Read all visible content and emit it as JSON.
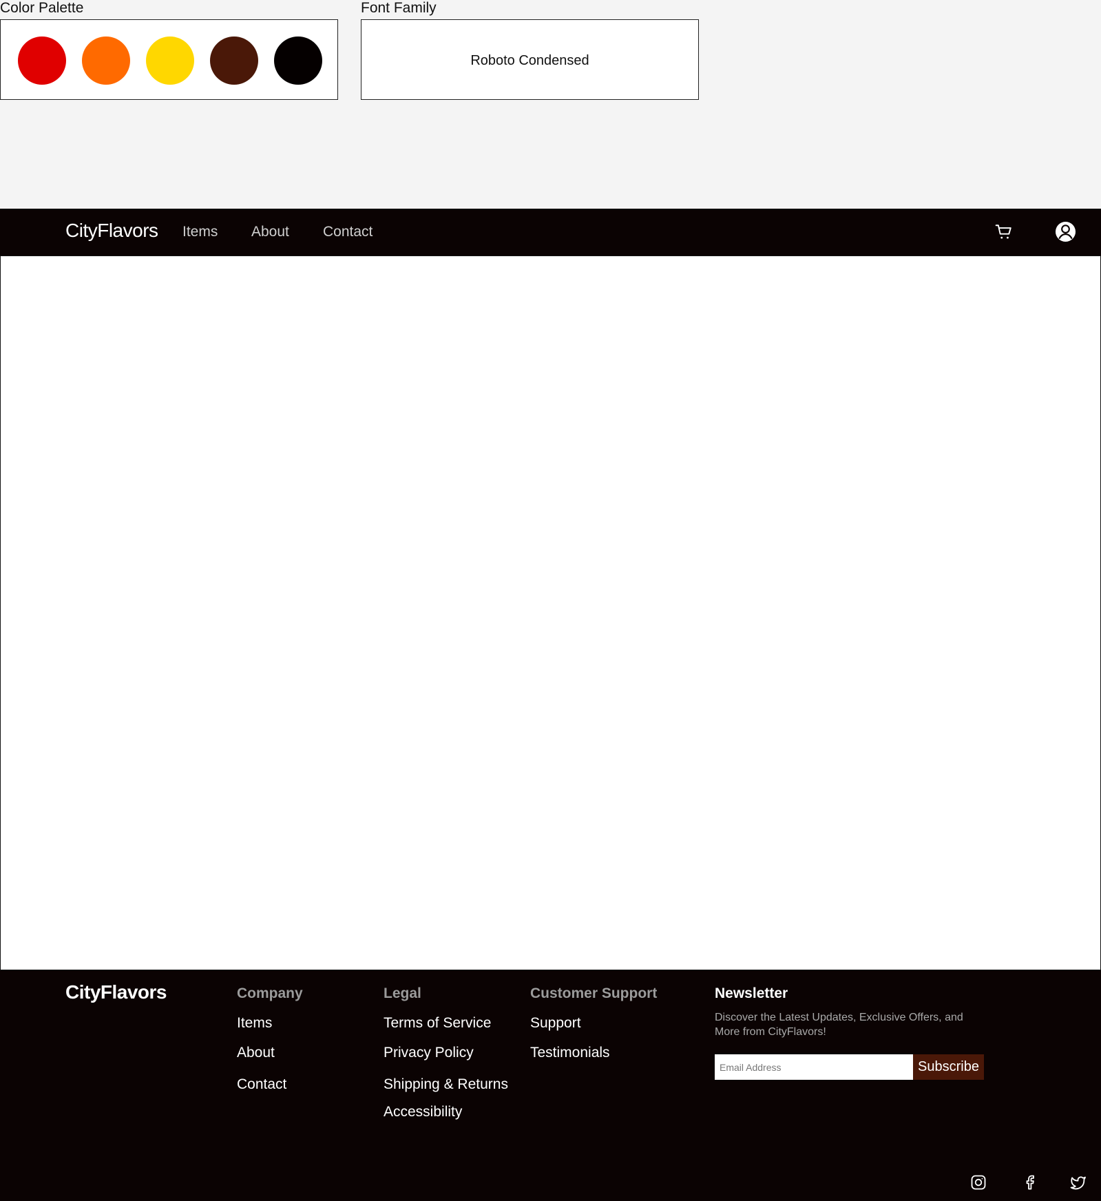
{
  "style_guide": {
    "color_palette_label": "Color Palette",
    "colors": [
      "#e00000",
      "#ff6a00",
      "#ffd700",
      "#4a1808",
      "#050000"
    ],
    "font_family_label": "Font Family",
    "font_sample": "Roboto Condensed"
  },
  "navbar": {
    "brand": "CityFlavors",
    "links": [
      "Items",
      "About",
      "Contact"
    ],
    "icons": [
      "cart-icon",
      "user-icon"
    ]
  },
  "footer": {
    "brand": "CityFlavors",
    "company": {
      "heading": "Company",
      "links": [
        "Items",
        "About",
        "Contact"
      ]
    },
    "legal": {
      "heading": "Legal",
      "links": [
        "Terms of Service",
        "Privacy Policy",
        "Shipping & Returns",
        "Accessibility"
      ]
    },
    "support": {
      "heading": "Customer Support",
      "links": [
        "Support",
        "Testimonials"
      ]
    },
    "newsletter": {
      "heading": "Newsletter",
      "description": "Discover the Latest Updates, Exclusive Offers, and More from CityFlavors!",
      "email_placeholder": "Email Address",
      "email_value": "",
      "subscribe_label": "Subscribe"
    },
    "social_icons": [
      "instagram-icon",
      "facebook-icon",
      "twitter-icon"
    ]
  }
}
